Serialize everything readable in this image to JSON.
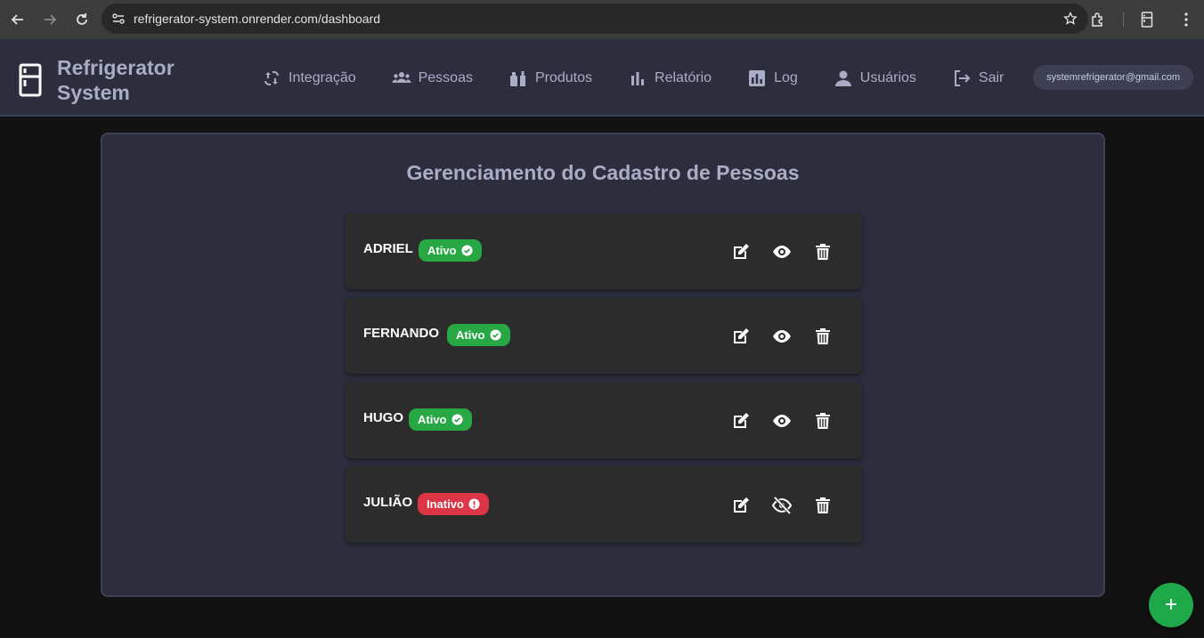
{
  "browser": {
    "url": "refrigerator-system.onrender.com/dashboard"
  },
  "header": {
    "brand_line1": "Refrigerator",
    "brand_line2": "System",
    "nav": [
      {
        "label": "Integração",
        "icon": "integration-icon"
      },
      {
        "label": "Pessoas",
        "icon": "people-icon"
      },
      {
        "label": "Produtos",
        "icon": "products-icon"
      },
      {
        "label": "Relatório",
        "icon": "bar-chart-icon"
      },
      {
        "label": "Log",
        "icon": "log-icon"
      },
      {
        "label": "Usuários",
        "icon": "user-icon"
      },
      {
        "label": "Sair",
        "icon": "logout-icon"
      }
    ],
    "user_email": "systemrefrigerator@gmail.com"
  },
  "main": {
    "title": "Gerenciamento do Cadastro de Pessoas",
    "people": [
      {
        "name": "ADRIEL",
        "status": "Ativo",
        "active": true
      },
      {
        "name": "FERNANDO",
        "status": "Ativo",
        "active": true
      },
      {
        "name": "HUGO",
        "status": "Ativo",
        "active": true
      },
      {
        "name": "JULIÃO",
        "status": "Inativo",
        "active": false
      }
    ],
    "fab_label": "+"
  },
  "colors": {
    "active": "#28a745",
    "inactive": "#dc3545",
    "accent": "#a9adc6",
    "fab": "#1ea84a"
  }
}
